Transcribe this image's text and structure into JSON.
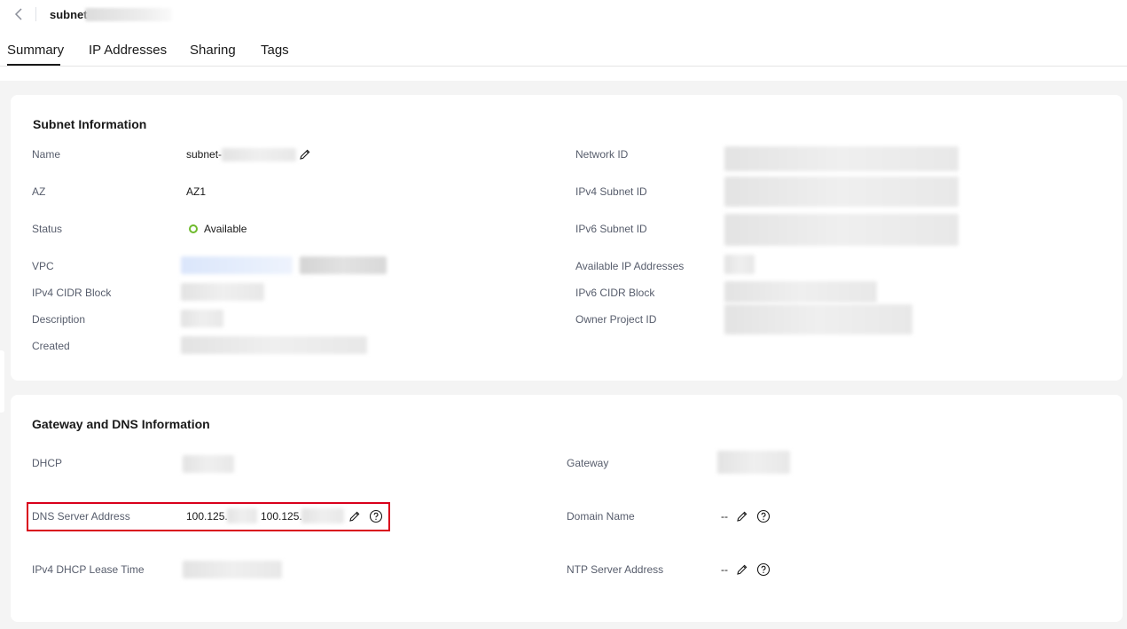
{
  "header": {
    "title": "subnet-"
  },
  "tabs": [
    {
      "label": "Summary"
    },
    {
      "label": "IP Addresses"
    },
    {
      "label": "Sharing"
    },
    {
      "label": "Tags"
    }
  ],
  "active_tab": "Summary",
  "subnet_info": {
    "title": "Subnet Information",
    "name_label": "Name",
    "name_value": "subnet-",
    "az_label": "AZ",
    "az_value": "AZ1",
    "status_label": "Status",
    "status_value": "Available",
    "status_color": "#6eba2c",
    "vpc_label": "VPC",
    "ipv4_cidr_label": "IPv4 CIDR Block",
    "description_label": "Description",
    "created_label": "Created",
    "network_id_label": "Network ID",
    "ipv4_subnet_id_label": "IPv4 Subnet ID",
    "ipv6_subnet_id_label": "IPv6 Subnet ID",
    "available_ip_label": "Available IP Addresses",
    "ipv6_cidr_label": "IPv6 CIDR Block",
    "owner_project_label": "Owner Project ID"
  },
  "gateway_dns": {
    "title": "Gateway and DNS Information",
    "dhcp_label": "DHCP",
    "dns_label": "DNS Server Address",
    "dns_value_1": "100.125.",
    "dns_value_2": "100.125.",
    "lease_label": "IPv4 DHCP Lease Time",
    "gateway_label": "Gateway",
    "domain_label": "Domain Name",
    "domain_value": "--",
    "ntp_label": "NTP Server Address",
    "ntp_value": "--"
  },
  "colors": {
    "highlight": "#d9001b",
    "link_blur": "#dbe6fb"
  }
}
